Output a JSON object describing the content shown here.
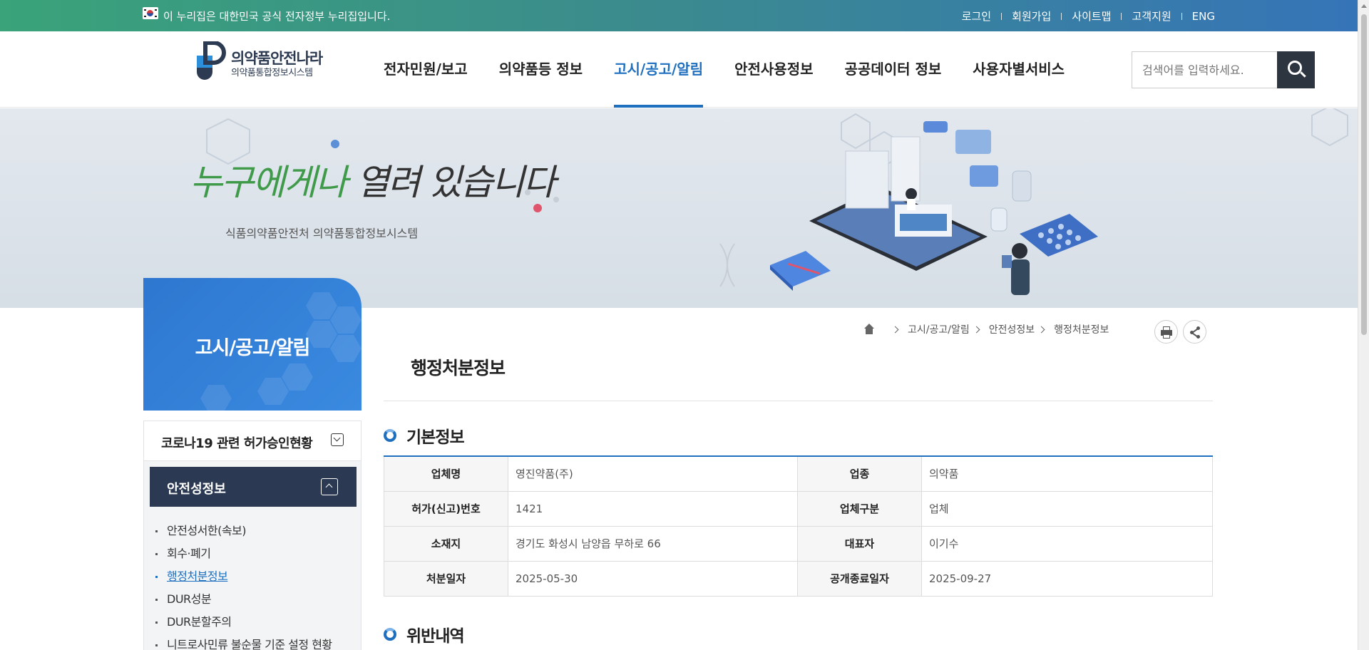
{
  "gov_bar": {
    "text": "이 누리집은 대한민국 공식 전자정부 누리집입니다.",
    "links": [
      "로그인",
      "회원가입",
      "사이트맵",
      "고객지원",
      "ENG"
    ]
  },
  "logo": {
    "title": "의약품안전나라",
    "subtitle": "의약품통합정보시스템"
  },
  "gnb": [
    "전자민원/보고",
    "의약품등 정보",
    "고시/공고/알림",
    "안전사용정보",
    "공공데이터 정보",
    "사용자별서비스"
  ],
  "gnb_active_index": 2,
  "search": {
    "placeholder": "검색어를 입력하세요."
  },
  "banner": {
    "slogan_green": "누구에게나",
    "slogan_dark": "열려 있습니다",
    "sub": "식품의약품안전처 의약품통합정보시스템"
  },
  "lnb": {
    "title": "고시/공고/알림",
    "select": "코로나19 관련 허가승인현황",
    "section": "안전성정보",
    "items": [
      "안전성서한(속보)",
      "회수·폐기",
      "행정처분정보",
      "DUR성분",
      "DUR분할주의",
      "니트로사민류 불순물 기준 설정 현황"
    ],
    "active_index": 2
  },
  "breadcrumb": [
    "고시/공고/알림",
    "안전성정보",
    "행정처분정보"
  ],
  "page_title": "행정처분정보",
  "basic_info": {
    "title": "기본정보",
    "rows": [
      [
        "업체명",
        "영진약품(주)",
        "업종",
        "의약품"
      ],
      [
        "허가(신고)번호",
        "1421",
        "업체구분",
        "업체"
      ],
      [
        "소재지",
        "경기도 화성시 남양읍 무하로 66",
        "대표자",
        "이기수"
      ],
      [
        "처분일자",
        "2025-05-30",
        "공개종료일자",
        "2025-09-27"
      ]
    ]
  },
  "violation": {
    "title": "위반내역"
  },
  "colors": {
    "accent": "#1f6fbf",
    "nav_dark": "#2b3a52",
    "lnb_blue": "#2e77d0"
  }
}
